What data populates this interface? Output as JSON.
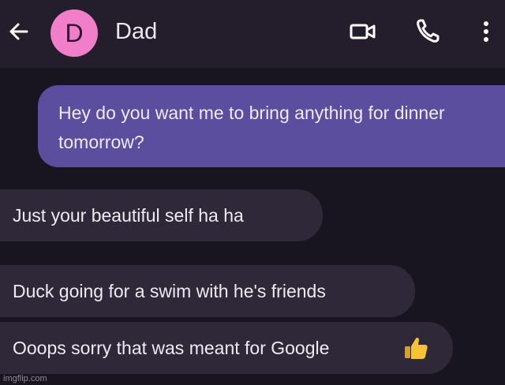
{
  "header": {
    "avatar_letter": "D",
    "contact_name": "Dad",
    "icons": [
      "back-arrow-icon",
      "video-call-icon",
      "phone-icon",
      "more-vert-icon"
    ]
  },
  "messages": [
    {
      "direction": "outgoing",
      "text": "Hey do you want me to bring anything for dinner tomorrow?"
    },
    {
      "direction": "incoming",
      "text": "Just your beautiful self ha ha"
    },
    {
      "direction": "incoming",
      "text": "Duck going for a swim with he's friends"
    },
    {
      "direction": "incoming",
      "text": "Ooops sorry that was meant for Google",
      "emoji_icon": "thumbs-up-icon"
    }
  ],
  "watermark": "imgflip.com",
  "colors": {
    "background": "#181520",
    "header": "#241d2c",
    "avatar": "#f07ec8",
    "outgoing_bubble": "#5b4e9f",
    "incoming_bubble": "#2e2838",
    "thumbs_up": "#f7c233"
  }
}
